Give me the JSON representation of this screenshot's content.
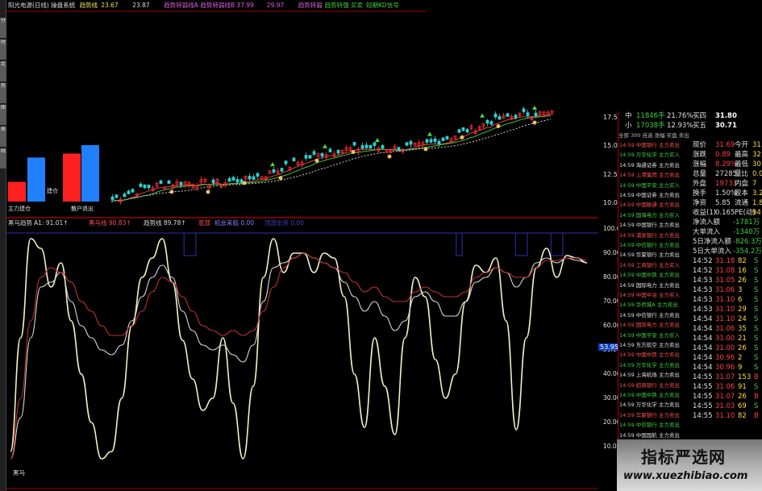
{
  "top_header": [
    {
      "text": "阳光电源(日线) 操盘系统",
      "color": "#dcdcdc"
    },
    {
      "text": "趋势线",
      "color": "#e8e060"
    },
    {
      "text": "23.67",
      "color": "#e8e060"
    },
    {
      "text": "23.87",
      "color": "#dcdcdc"
    },
    {
      "text": "趋势转弱线A",
      "color": "#e060e0"
    },
    {
      "text": "趋势转弱线B 37.99",
      "color": "#e060e0"
    },
    {
      "text": "29.97",
      "color": "#e060e0"
    },
    {
      "text": "趋势转弱",
      "color": "#e060e0"
    },
    {
      "text": "趋势转强 买卖",
      "color": "#40d040"
    },
    {
      "text": "短期KD信号",
      "color": "#40d040"
    }
  ],
  "side_tabs": [
    "分",
    "时",
    "走",
    "势",
    "图",
    "表",
    "线"
  ],
  "kline_labels": {
    "buy": "建仓",
    "sell": "散户退出",
    "low": "主力建仓"
  },
  "price_ticks": [
    "17.50",
    "15.00",
    "12.50",
    "10.00"
  ],
  "osc_header": [
    {
      "text": "黑马趋势",
      "color": "#dcdcdc"
    },
    {
      "text": "A1: 91.01↑",
      "color": "#dcdcdc"
    },
    {
      "text": "黑马线 90.83↑",
      "color": "#ff5050"
    },
    {
      "text": "趋势线 89.78↑",
      "color": "#dcdcdc"
    },
    {
      "text": "底部",
      "color": "#ff5050"
    },
    {
      "text": "机会来临 0.00",
      "color": "#8080ff"
    },
    {
      "text": "顶部出货 0.00",
      "color": "#4040c0"
    }
  ],
  "osc_ticks": [
    "100.0",
    "90.00",
    "80.00",
    "70.00",
    "60.00",
    "50.00",
    "40.00",
    "30.00",
    "20.00",
    "10.00"
  ],
  "osc_cursor_label": "53.95",
  "osc_bottom_label": "黑马",
  "chart_data": {
    "type": "line",
    "panels": [
      {
        "name": "kline",
        "ylim": [
          10.0,
          18.5
        ],
        "y_ticks": [
          10.0,
          12.5,
          15.0,
          17.5
        ],
        "volume_bars": [
          {
            "color": "#ff2020",
            "value": 0.35
          },
          {
            "color": "#2080ff",
            "value": 0.78
          },
          {
            "color": "#ff2020",
            "value": 0.85
          },
          {
            "color": "#2080ff",
            "value": 1.0
          }
        ]
      },
      {
        "name": "oscillator",
        "ylim": [
          0,
          100
        ],
        "series": [
          {
            "color": "#f0efc0",
            "values": [
              8,
              55,
              96,
              92,
              76,
              86,
              62,
              40,
              20,
              5,
              8,
              30,
              60,
              80,
              88,
              96,
              78,
              54,
              38,
              25,
              30,
              55,
              28,
              5,
              35,
              80,
              96,
              82,
              90,
              90,
              82,
              90,
              88,
              72,
              40,
              18,
              55,
              35,
              15,
              55,
              80,
              72,
              46,
              30,
              40,
              70,
              85,
              82,
              88,
              62,
              17,
              55,
              84,
              92,
              80,
              89,
              88,
              86
            ]
          },
          {
            "color": "#d7d7d7",
            "values": [
              5,
              22,
              55,
              76,
              78,
              82,
              70,
              60,
              55,
              50,
              48,
              52,
              62,
              72,
              80,
              85,
              80,
              66,
              58,
              52,
              50,
              52,
              48,
              45,
              52,
              70,
              84,
              86,
              88,
              90,
              88,
              86,
              84,
              78,
              72,
              66,
              70,
              64,
              58,
              62,
              72,
              74,
              70,
              64,
              64,
              70,
              78,
              80,
              84,
              82,
              76,
              80,
              86,
              88,
              86,
              88,
              87,
              86
            ]
          },
          {
            "color": "#c03030",
            "values": [
              5,
              30,
              62,
              80,
              84,
              82,
              78,
              70,
              66,
              60,
              56,
              56,
              60,
              66,
              74,
              80,
              78,
              72,
              66,
              60,
              58,
              56,
              58,
              56,
              58,
              66,
              76,
              84,
              88,
              90,
              88,
              86,
              84,
              82,
              78,
              74,
              76,
              72,
              70,
              70,
              74,
              76,
              74,
              72,
              72,
              74,
              80,
              82,
              84,
              82,
              80,
              80,
              84,
              87,
              87,
              88,
              88,
              87
            ]
          }
        ],
        "top_band": [
          {
            "color": "#3030c0",
            "segments": [
              [
                0.3,
                0.32
              ],
              [
                0.76,
                0.77
              ],
              [
                0.86,
                0.88
              ],
              [
                0.92,
                0.94
              ]
            ]
          }
        ]
      }
    ]
  },
  "quote": {
    "top_rows": [
      {
        "label": "中",
        "value": "11846手",
        "pct": "21.76%",
        "k": "买四",
        "v": "31.80",
        "color": "#40d040"
      },
      {
        "label": "小",
        "value": "17038手",
        "pct": "12.93%",
        "k": "买五",
        "v": "30.71",
        "color": "#40d040"
      }
    ],
    "tabs": "全部 300 自选 涨幅 买盘 卖出",
    "stats": [
      {
        "k": "现价",
        "v": "31.69",
        "k2": "今开",
        "v2": "31.2",
        "c": "#ff4040"
      },
      {
        "k": "涨跌",
        "v": "0.89",
        "k2": "最高",
        "v2": "32.",
        "c": "#ff4040"
      },
      {
        "k": "涨幅",
        "v": "8.29%",
        "k2": "最低",
        "v2": "30.",
        "c": "#ff4040"
      },
      {
        "k": "总量",
        "v": "27285",
        "k2": "量比",
        "v2": "0.0",
        "c": "#dcdcdc"
      },
      {
        "k": "外盘",
        "v": "19733",
        "k2": "内盘",
        "v2": "7",
        "c": "#ff4040"
      },
      {
        "k": "换手",
        "v": "1.50%",
        "k2": "股本",
        "v2": "3.27",
        "c": "#dcdcdc"
      },
      {
        "k": "净资",
        "v": "5.85",
        "k2": "流通",
        "v2": "1.8",
        "c": "#dcdcdc"
      },
      {
        "k": "收益(1)",
        "v": "0.165",
        "k2": "PE(动)",
        "v2": "94",
        "c": "#dcdcdc"
      }
    ],
    "flows": [
      {
        "k": "净流入额",
        "v": "-1781万",
        "c": "#40d040"
      },
      {
        "k": "大单流入",
        "v": "-1340万",
        "c": "#40d040"
      },
      {
        "k": "5日净流入额",
        "v": "-826.3万",
        "c": "#40d040"
      },
      {
        "k": "5日大单流入",
        "v": "-354.2万",
        "c": "#40d040"
      }
    ],
    "ticks": [
      {
        "t": "14:52",
        "p": "31.18",
        "v": "82",
        "s": "S"
      },
      {
        "t": "14:52",
        "p": "31.08",
        "v": "16",
        "s": "S"
      },
      {
        "t": "14:53",
        "p": "31.05",
        "v": "26",
        "s": "S"
      },
      {
        "t": "14:53",
        "p": "31.06",
        "v": "3",
        "s": "S"
      },
      {
        "t": "14:53",
        "p": "31.10",
        "v": "6",
        "s": "S"
      },
      {
        "t": "14:53",
        "p": "31.10",
        "v": "29",
        "s": "S"
      },
      {
        "t": "14:54",
        "p": "31.10",
        "v": "24",
        "s": "S"
      },
      {
        "t": "14:54",
        "p": "31.06",
        "v": "35",
        "s": "S"
      },
      {
        "t": "14:54",
        "p": "31.00",
        "v": "21",
        "s": "S"
      },
      {
        "t": "14:54",
        "p": "31.00",
        "v": "26",
        "s": "S"
      },
      {
        "t": "14:54",
        "p": "30.96",
        "v": "2",
        "s": "S"
      },
      {
        "t": "14:54",
        "p": "30.96",
        "v": "9",
        "s": "S"
      },
      {
        "t": "14:55",
        "p": "31.07",
        "v": "153",
        "s": "B"
      },
      {
        "t": "14:55",
        "p": "31.06",
        "v": "91",
        "s": "S"
      },
      {
        "t": "14:55",
        "p": "31.07",
        "v": "26",
        "s": "B"
      },
      {
        "t": "14:55",
        "p": "31.03",
        "v": "69",
        "s": "S"
      },
      {
        "t": "14:55",
        "p": "31.10",
        "v": "82",
        "s": "B"
      }
    ],
    "news": [
      "14:59 中国银行 主力卖出",
      "14:59 万华化学 主力买入",
      "14:59 海通证券 主力卖出",
      "14:59 上港集团 主力卖出",
      "14:59 中国平安 主力买入",
      "14:59 中国证券 主力卖出",
      "14:59 中国联通 主力卖出",
      "14:59 国海电力 主力买入",
      "14:59 中国银行 主力卖出",
      "14:59 浦发银行 主力卖出",
      "14:59 中信银行 主力卖出",
      "14:59 华夏银行 主力卖出",
      "14:59 工商银行 主力买入",
      "14:59 中国中铁 主力卖出",
      "14:59 国际电力 主力卖出",
      "14:59 中国中冶 主力买入",
      "14:59 华侨城A 主力卖出",
      "14:59 中信银行 主力卖出",
      "14:59 国际电力 主力卖出",
      "14:59 中国平安 主力买入",
      "14:59 东方航空 主力卖出",
      "14:59 中国中铁 主力卖出",
      "14:59 万华化学 主力卖出",
      "14:59 上海机场 主力卖出",
      "14:59 招商银行 主力卖出",
      "14:59 中国中铁 主力卖出",
      "14:59 万华化学 主力卖出",
      "14:59 华夏银行 主力卖出",
      "14:59 中信银行 主力卖出",
      "14:59 中国国航 主力卖出",
      "14:59 万华化学 主力卖出",
      "14:59 民生银行 主力卖出",
      "14:59 东方证券 主力卖出"
    ]
  },
  "watermark": {
    "title": "指标严选网",
    "url": "www.xuezhibiao.com"
  }
}
